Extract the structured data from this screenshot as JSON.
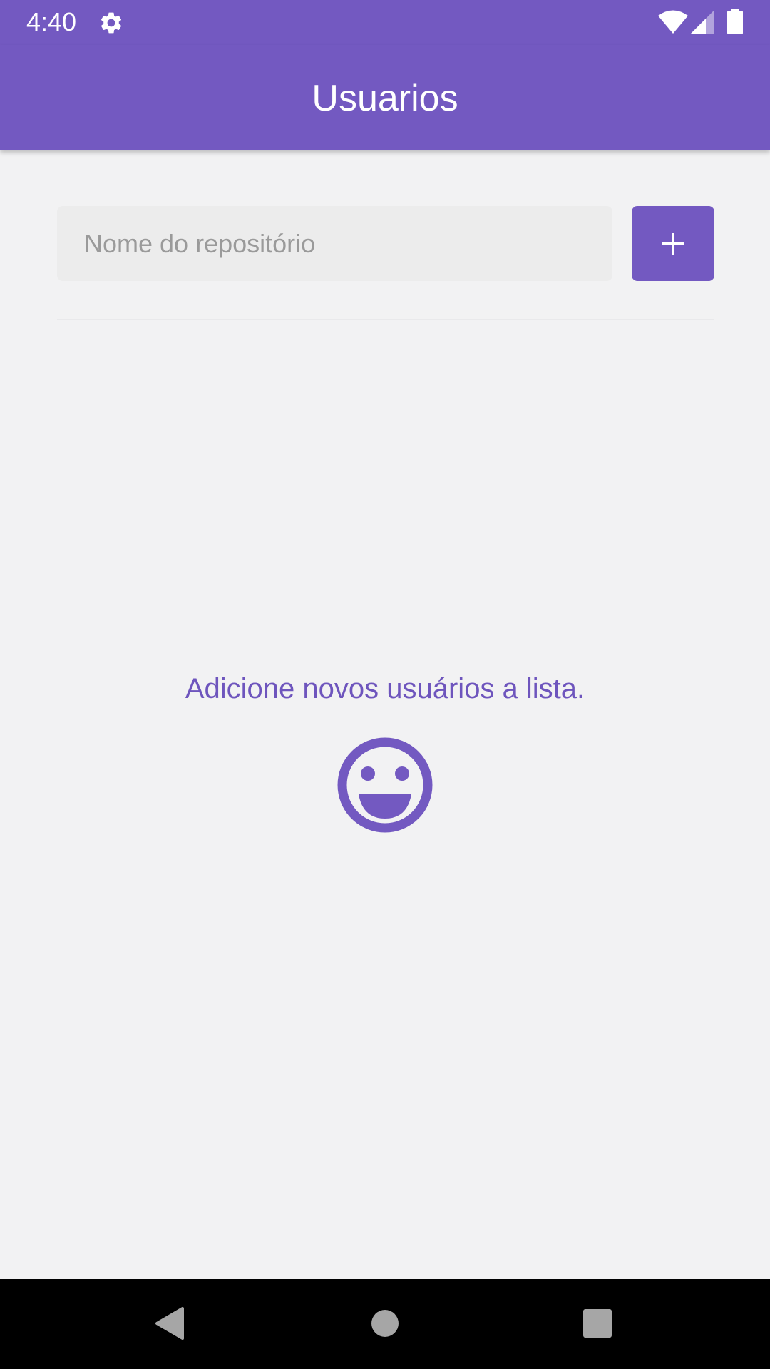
{
  "status_bar": {
    "time": "4:40",
    "icons": [
      "gear-icon",
      "wifi-icon",
      "cell-signal-icon",
      "battery-icon"
    ]
  },
  "app_bar": {
    "title": "Usuarios"
  },
  "form": {
    "input_value": "",
    "input_placeholder": "Nome do repositório",
    "add_button_icon": "plus-icon"
  },
  "empty_state": {
    "message": "Adicione novos usuários a lista.",
    "icon": "smiley-icon"
  },
  "nav_bar": {
    "icons": [
      "back-icon",
      "home-icon",
      "recents-icon"
    ]
  },
  "colors": {
    "primary": "#7359c1",
    "background": "#f2f2f3",
    "input_background": "#ececec",
    "placeholder": "#9a9a9a",
    "nav_bar": "#000000"
  }
}
